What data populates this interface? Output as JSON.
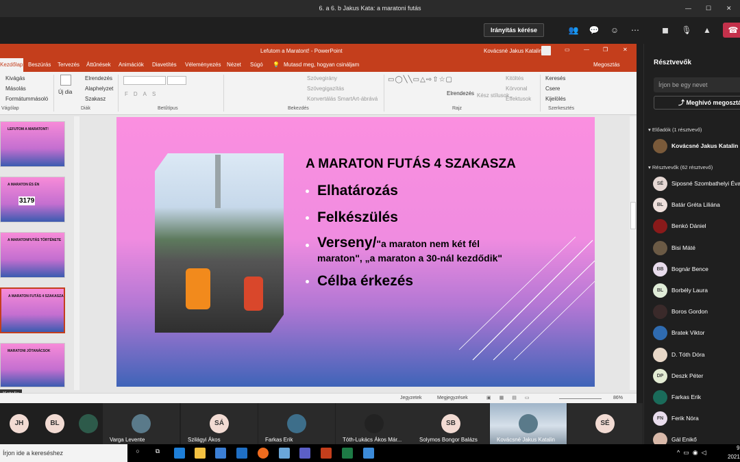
{
  "window_title": "6. a 6. b Jakus Kata: a maratoni futás",
  "teams": {
    "control_button": "Irányítás kérése"
  },
  "ppt": {
    "doc_title": "Lefutom a Maratont! - PowerPoint",
    "user": "Kovácsné Jakus Katalin",
    "tabs": [
      "Kezdőlap",
      "Beszúrás",
      "Tervezés",
      "Áttűnések",
      "Animációk",
      "Diavetítés",
      "Véleményezés",
      "Nézet",
      "Súgó"
    ],
    "tell_me": "Mutasd meg, hogyan csináljam",
    "share": "Megosztás",
    "ribbon": {
      "clipboard": [
        "Kivágás",
        "Másolás",
        "Formátummásoló"
      ],
      "clipboard_group": "Vágólap",
      "new_slide": "Új dia",
      "slides": [
        "Elrendezés",
        "Alaphelyzet",
        "Szakasz"
      ],
      "slides_group": "Diák",
      "font_group": "Betűtípus",
      "paragraph": [
        "Szövegirány",
        "Szövegigazítás",
        "Konvertálás SmartArt-ábrává"
      ],
      "paragraph_group": "Bekezdés",
      "arrange": "Elrendezés",
      "quick_styles": "Kész stílusok",
      "drawing": [
        "Kitöltés",
        "Körvonal",
        "Effektusok"
      ],
      "drawing_group": "Rajz",
      "editing": [
        "Keresés",
        "Csere",
        "Kijelölés"
      ],
      "editing_group": "Szerkesztés"
    },
    "thumbnails": [
      "LEFUTOM A MARATONT!",
      "A MARATON ÉS ÉN",
      "A MARATONFUTÁS TÖRTÉNETE",
      "A MARATON FUTÁS 4 SZAKASZA",
      "MARATONI JÓTANÁCSOK"
    ],
    "thumb_bib": "3179",
    "presenter_tag": "Katalin",
    "slide": {
      "title": "A MARATON FUTÁS 4 SZAKASZA",
      "bullets": [
        "Elhatározás",
        "Felkészülés"
      ],
      "bullet3_main": "Verseny/",
      "bullet3_quote_a": "\"a maraton nem két fél",
      "bullet3_quote_b": "maraton\", „a maraton a 30-nál kezdődik\"",
      "bullet4": "Célba érkezés"
    },
    "status": {
      "notes": "Jegyzetek",
      "comments": "Megjegyzések",
      "zoom": "86%"
    }
  },
  "participants": {
    "header": "Résztvevők",
    "search_placeholder": "Írjon be egy nevet",
    "share_label": "Meghívó megosztá",
    "presenters_label": "Előadók (1 résztvevő)",
    "presenter": "Kovácsné Jakus Katalin",
    "attendees_label": "Résztvevők (62 résztvevő)",
    "attendees": [
      {
        "name": "Siposné Szombathelyi Éva",
        "initials": "SÉ"
      },
      {
        "name": "Batár Gréta Liliána",
        "initials": "BL"
      },
      {
        "name": "Benkó Dániel",
        "initials": ""
      },
      {
        "name": "Bisi Máté",
        "initials": ""
      },
      {
        "name": "Bognár Bence",
        "initials": "BB"
      },
      {
        "name": "Borbély Laura",
        "initials": "BL"
      },
      {
        "name": "Boros Gordon",
        "initials": ""
      },
      {
        "name": "Bratek Viktor",
        "initials": ""
      },
      {
        "name": "D. Tóth Dóra",
        "initials": ""
      },
      {
        "name": "Deszk Péter",
        "initials": "DP"
      },
      {
        "name": "Farkas Erik",
        "initials": ""
      },
      {
        "name": "Ferik Nóra",
        "initials": "FN"
      },
      {
        "name": "Gál Enikő",
        "initials": ""
      }
    ]
  },
  "video": [
    {
      "initials": "JH",
      "name": ""
    },
    {
      "initials": "BL",
      "name": ""
    },
    {
      "initials": "",
      "name": ""
    },
    {
      "initials": "",
      "name": "Varga Levente"
    },
    {
      "initials": "SÁ",
      "name": "Szilágyi Ákos"
    },
    {
      "initials": "",
      "name": "Farkas Erik"
    },
    {
      "initials": "",
      "name": "Tóth-Lukács Ákos Már..."
    },
    {
      "initials": "SB",
      "name": "Solymos Bongor Balázs"
    },
    {
      "initials": "",
      "name": "Kovácsné Jakus Katalin"
    },
    {
      "initials": "SÉ",
      "name": ""
    }
  ],
  "taskbar": {
    "search": "Írjon ide a kereséshez",
    "clock": "9",
    "date": "2021."
  }
}
